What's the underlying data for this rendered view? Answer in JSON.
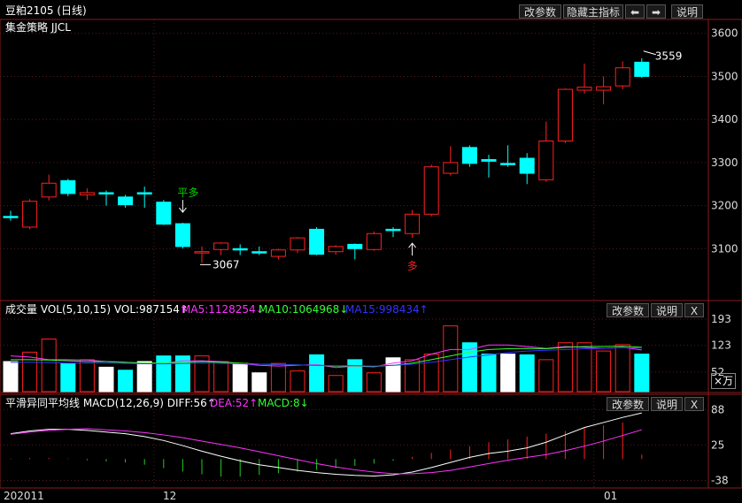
{
  "header": {
    "title": "豆粕2105 (日线)",
    "subtitle": "集金策略 JJCL",
    "buttons": [
      "改参数",
      "隐藏主指标",
      "说明"
    ],
    "nav_icons": [
      "arrow-left-icon",
      "arrow-right-icon"
    ]
  },
  "chart_data": [
    {
      "type": "candlestick",
      "panel": "main",
      "ylim": [
        3000,
        3620
      ],
      "yticks": [
        3100,
        3200,
        3300,
        3400,
        3500,
        3600
      ],
      "xticks": [
        "202011",
        "12",
        "01"
      ],
      "colors": {
        "up": "#ff2020",
        "down": "#00ffff",
        "background": "#000000",
        "grid": "#5a1a1a"
      },
      "candles": [
        {
          "o": 3175,
          "h": 3188,
          "l": 3165,
          "c": 3175
        },
        {
          "o": 3150,
          "h": 3215,
          "l": 3145,
          "c": 3210
        },
        {
          "o": 3220,
          "h": 3272,
          "l": 3212,
          "c": 3252
        },
        {
          "o": 3258,
          "h": 3262,
          "l": 3222,
          "c": 3228
        },
        {
          "o": 3225,
          "h": 3240,
          "l": 3213,
          "c": 3230
        },
        {
          "o": 3230,
          "h": 3235,
          "l": 3200,
          "c": 3228
        },
        {
          "o": 3220,
          "h": 3225,
          "l": 3195,
          "c": 3202
        },
        {
          "o": 3230,
          "h": 3244,
          "l": 3195,
          "c": 3230
        },
        {
          "o": 3208,
          "h": 3213,
          "l": 3155,
          "c": 3157
        },
        {
          "o": 3158,
          "h": 3160,
          "l": 3100,
          "c": 3105
        },
        {
          "o": 3090,
          "h": 3105,
          "l": 3067,
          "c": 3093
        },
        {
          "o": 3098,
          "h": 3115,
          "l": 3085,
          "c": 3113
        },
        {
          "o": 3100,
          "h": 3110,
          "l": 3085,
          "c": 3100
        },
        {
          "o": 3093,
          "h": 3105,
          "l": 3085,
          "c": 3093
        },
        {
          "o": 3082,
          "h": 3100,
          "l": 3075,
          "c": 3097
        },
        {
          "o": 3097,
          "h": 3127,
          "l": 3090,
          "c": 3125
        },
        {
          "o": 3145,
          "h": 3150,
          "l": 3085,
          "c": 3087
        },
        {
          "o": 3093,
          "h": 3108,
          "l": 3086,
          "c": 3105
        },
        {
          "o": 3110,
          "h": 3112,
          "l": 3075,
          "c": 3100
        },
        {
          "o": 3098,
          "h": 3140,
          "l": 3095,
          "c": 3135
        },
        {
          "o": 3145,
          "h": 3150,
          "l": 3127,
          "c": 3143
        },
        {
          "o": 3135,
          "h": 3190,
          "l": 3125,
          "c": 3180
        },
        {
          "o": 3180,
          "h": 3295,
          "l": 3175,
          "c": 3290
        },
        {
          "o": 3275,
          "h": 3338,
          "l": 3270,
          "c": 3300
        },
        {
          "o": 3335,
          "h": 3340,
          "l": 3290,
          "c": 3298
        },
        {
          "o": 3307,
          "h": 3318,
          "l": 3265,
          "c": 3303
        },
        {
          "o": 3298,
          "h": 3340,
          "l": 3290,
          "c": 3298
        },
        {
          "o": 3310,
          "h": 3322,
          "l": 3250,
          "c": 3275
        },
        {
          "o": 3260,
          "h": 3395,
          "l": 3255,
          "c": 3350
        },
        {
          "o": 3350,
          "h": 3472,
          "l": 3345,
          "c": 3470
        },
        {
          "o": 3468,
          "h": 3530,
          "l": 3460,
          "c": 3475
        },
        {
          "o": 3468,
          "h": 3500,
          "l": 3435,
          "c": 3476
        },
        {
          "o": 3478,
          "h": 3535,
          "l": 3470,
          "c": 3520
        },
        {
          "o": 3533,
          "h": 3542,
          "l": 3497,
          "c": 3500
        }
      ],
      "annotations": [
        {
          "text": "平多",
          "color": "#00d000",
          "candle": 9,
          "arrow": "down"
        },
        {
          "text": "多",
          "color": "#ff2020",
          "candle": 21,
          "arrow": "up"
        },
        {
          "text": "3067",
          "color": "#ffffff",
          "candle": 10,
          "value": 3067
        },
        {
          "text": "3559",
          "color": "#ffffff",
          "candle": 33,
          "value": 3559
        }
      ]
    },
    {
      "type": "bar",
      "panel": "volume",
      "label": "成交量 VOL(5,10,15) VOL:987154↑",
      "ma_labels": [
        {
          "text": "MA5:1128254↓",
          "color": "#ff33ff"
        },
        {
          "text": "MA10:1064968↓",
          "color": "#33ff33"
        },
        {
          "text": "MA15:998434↑",
          "color": "#3333ff"
        }
      ],
      "unit_label": "×万",
      "buttons": [
        "改参数",
        "说明",
        "X"
      ],
      "ylim": [
        0,
        200
      ],
      "yticks": [
        52,
        123,
        193
      ],
      "values": [
        80,
        105,
        140,
        75,
        85,
        65,
        57,
        80,
        95,
        95,
        95,
        80,
        75,
        50,
        75,
        55,
        98,
        43,
        85,
        50,
        90,
        85,
        100,
        175,
        130,
        100,
        100,
        98,
        85,
        130,
        130,
        108,
        125,
        100
      ],
      "ma5": [
        95,
        92,
        85,
        85,
        84,
        80,
        78,
        76,
        75,
        82,
        82,
        80,
        75,
        70,
        68,
        70,
        72,
        64,
        68,
        66,
        76,
        82,
        100,
        112,
        112,
        124,
        124,
        120,
        115,
        120,
        118,
        115,
        118,
        111
      ],
      "ma10": [
        85,
        85,
        84,
        82,
        80,
        80,
        78,
        76,
        76,
        78,
        80,
        78,
        76,
        73,
        72,
        71,
        70,
        68,
        68,
        67,
        70,
        76,
        85,
        95,
        105,
        112,
        114,
        115,
        114,
        118,
        120,
        120,
        121,
        118
      ],
      "ma15": [
        78,
        78,
        77,
        76,
        76,
        76,
        75,
        74,
        74,
        75,
        76,
        75,
        74,
        73,
        72,
        71,
        70,
        69,
        69,
        68,
        70,
        73,
        78,
        85,
        92,
        98,
        104,
        108,
        110,
        112,
        114,
        115,
        117,
        116
      ]
    },
    {
      "type": "macd",
      "panel": "macd",
      "label": "平滑异同平均线 MACD(12,26,9) DIFF:56↑",
      "dea_label": {
        "text": "DEA:52↑",
        "color": "#ff33ff"
      },
      "macd_label": {
        "text": "MACD:8↓",
        "color": "#33ff33"
      },
      "buttons": [
        "改参数",
        "说明",
        "X"
      ],
      "ylim": [
        -45,
        90
      ],
      "yticks": [
        -38,
        25,
        88
      ],
      "diff": [
        45,
        50,
        53,
        53,
        51,
        48,
        45,
        40,
        33,
        24,
        14,
        5,
        -3,
        -10,
        -15,
        -20,
        -24,
        -27,
        -29,
        -30,
        -28,
        -23,
        -15,
        -6,
        3,
        10,
        14,
        20,
        30,
        43,
        56,
        65,
        74,
        82
      ],
      "dea": [
        44,
        48,
        51,
        53,
        54,
        52,
        50,
        47,
        43,
        38,
        32,
        26,
        20,
        13,
        6,
        -1,
        -8,
        -14,
        -19,
        -23,
        -26,
        -26,
        -24,
        -20,
        -14,
        -8,
        -2,
        3,
        8,
        15,
        23,
        32,
        42,
        52
      ],
      "macd": [
        1,
        2,
        2,
        1,
        -2,
        -4,
        -6,
        -10,
        -16,
        -22,
        -27,
        -31,
        -31,
        -28,
        -25,
        -22,
        -19,
        -16,
        -12,
        -8,
        -3,
        4,
        11,
        17,
        23,
        30,
        35,
        40,
        45,
        50,
        55,
        60,
        65,
        8
      ]
    }
  ]
}
